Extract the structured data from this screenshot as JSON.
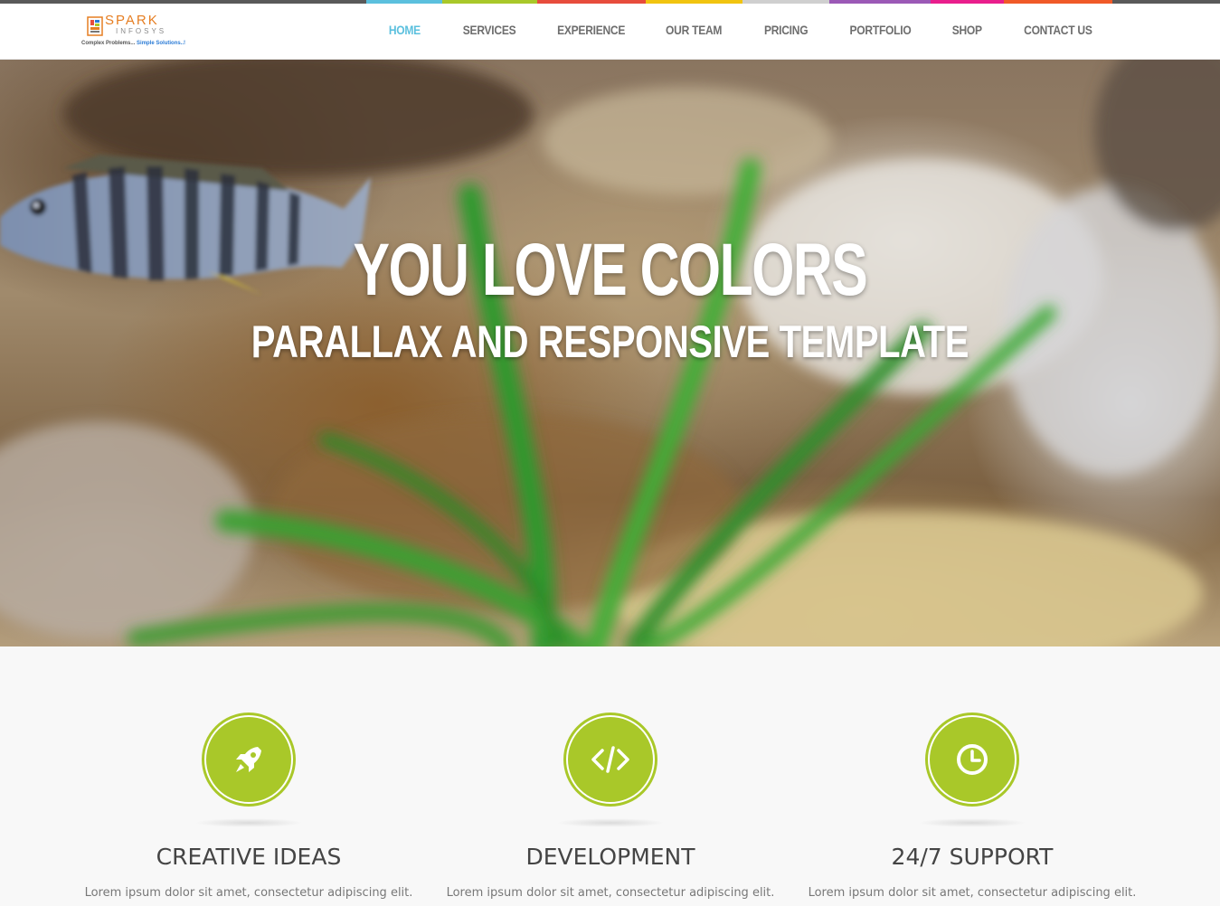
{
  "brand": {
    "name": "SPARK",
    "sub": "INFOSYS",
    "tagline_a": "Complex Problems...",
    "tagline_b": "Simple Solutions..!"
  },
  "nav": {
    "items": [
      {
        "label": "HOME",
        "color": "#5bc0de",
        "active": true
      },
      {
        "label": "SERVICES",
        "color": "#a9c829"
      },
      {
        "label": "EXPERIENCE",
        "color": "#e74c3c"
      },
      {
        "label": "OUR TEAM",
        "color": "#f1c40f"
      },
      {
        "label": "PRICING",
        "color": "#cfcfcf"
      },
      {
        "label": "PORTFOLIO",
        "color": "#9b59b6"
      },
      {
        "label": "SHOP",
        "color": "#e91e8c"
      },
      {
        "label": "CONTACT US",
        "color": "#f05a28"
      }
    ]
  },
  "hero": {
    "title": "YOU LOVE COLORS",
    "subtitle": "PARALLAX AND RESPONSIVE TEMPLATE"
  },
  "features": [
    {
      "icon": "rocket-icon",
      "title": "CREATIVE IDEAS",
      "desc": "Lorem ipsum dolor sit amet, consectetur adipiscing elit."
    },
    {
      "icon": "code-icon",
      "title": "DEVELOPMENT",
      "desc": "Lorem ipsum dolor sit amet, consectetur adipiscing elit."
    },
    {
      "icon": "clock-icon",
      "title": "24/7 SUPPORT",
      "desc": "Lorem ipsum dolor sit amet, consectetur adipiscing elit."
    }
  ],
  "colors": {
    "accent": "#a9c829",
    "nav_active": "#5bc0de"
  }
}
